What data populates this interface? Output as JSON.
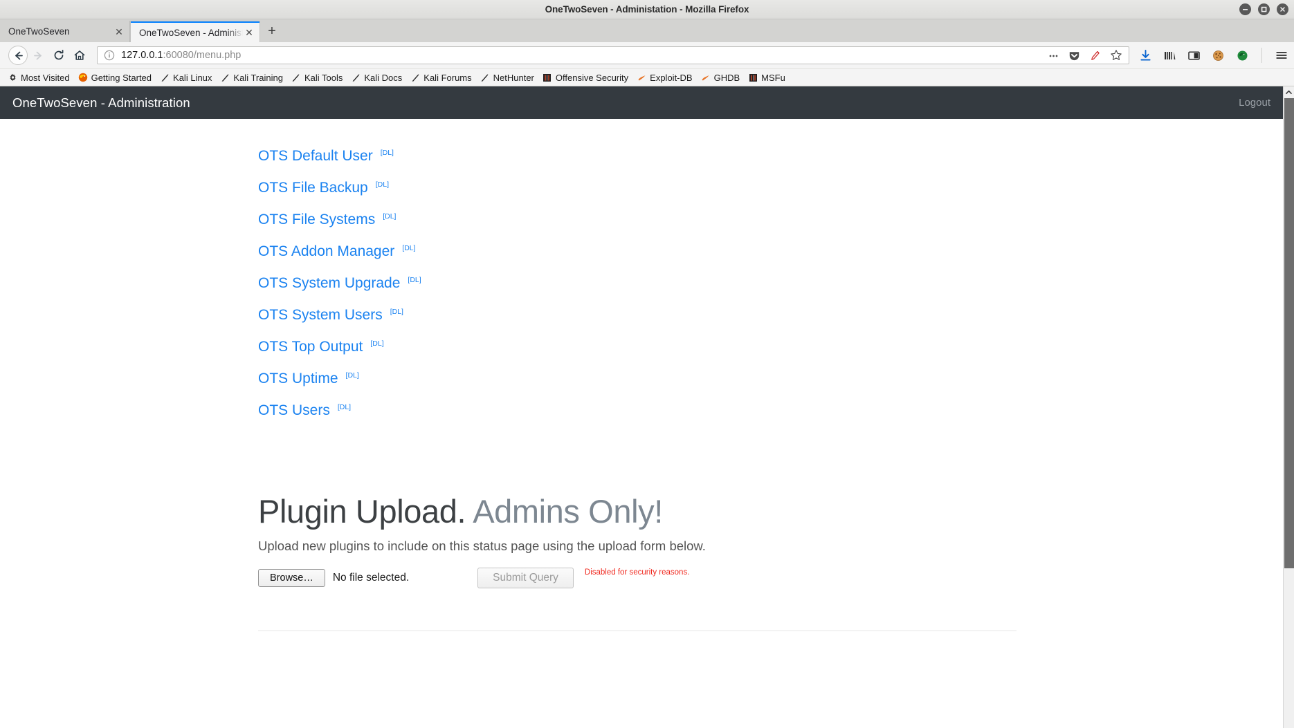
{
  "window": {
    "title": "OneTwoSeven - Administation - Mozilla Firefox",
    "controls": {
      "minimize": "minimize",
      "maximize": "maximize",
      "close": "close"
    }
  },
  "tabs": [
    {
      "label": "OneTwoSeven",
      "active": false
    },
    {
      "label": "OneTwoSeven - Administati",
      "active": true
    }
  ],
  "newtab_label": "+",
  "toolbar": {
    "back": "back-arrow",
    "forward": "forward-arrow",
    "reload": "reload",
    "home": "home",
    "url_host": "127.0.0.1",
    "url_rest": ":60080/menu.php",
    "url_full": "127.0.0.1:60080/menu.php",
    "page_actions": "page-actions-ellipsis",
    "pocket": "pocket-save",
    "reader": "reader-mode-pen",
    "bookmark": "bookmark-star",
    "downloads": "downloads-arrow",
    "library": "library-books",
    "sidebar": "sidebar-panel",
    "cookies": "cookie",
    "extension": "kali-dragon-extension",
    "menu": "hamburger-menu"
  },
  "bookmarks": [
    {
      "label": "Most Visited",
      "icon": "gear-icon"
    },
    {
      "label": "Getting Started",
      "icon": "firefox-icon"
    },
    {
      "label": "Kali Linux",
      "icon": "kali-dragon-icon"
    },
    {
      "label": "Kali Training",
      "icon": "kali-dragon-icon"
    },
    {
      "label": "Kali Tools",
      "icon": "kali-dragon-icon"
    },
    {
      "label": "Kali Docs",
      "icon": "kali-dragon-icon"
    },
    {
      "label": "Kali Forums",
      "icon": "kali-dragon-icon"
    },
    {
      "label": "NetHunter",
      "icon": "kali-dragon-icon"
    },
    {
      "label": "Offensive Security",
      "icon": "offsec-icon"
    },
    {
      "label": "Exploit-DB",
      "icon": "exploitdb-icon"
    },
    {
      "label": "GHDB",
      "icon": "exploitdb-icon"
    },
    {
      "label": "MSFu",
      "icon": "offsec-icon"
    }
  ],
  "page": {
    "header": {
      "brand": "OneTwoSeven - Administration",
      "logout": "Logout"
    },
    "plugin_links": [
      {
        "label": "OTS Default User",
        "dl": "[DL]"
      },
      {
        "label": "OTS File Backup",
        "dl": "[DL]"
      },
      {
        "label": "OTS File Systems",
        "dl": "[DL]"
      },
      {
        "label": "OTS Addon Manager",
        "dl": "[DL]"
      },
      {
        "label": "OTS System Upgrade",
        "dl": "[DL]"
      },
      {
        "label": "OTS System Users",
        "dl": "[DL]"
      },
      {
        "label": "OTS Top Output",
        "dl": "[DL]"
      },
      {
        "label": "OTS Uptime",
        "dl": "[DL]"
      },
      {
        "label": "OTS Users",
        "dl": "[DL]"
      }
    ],
    "upload": {
      "title_main": "Plugin Upload.",
      "title_muted": "Admins Only!",
      "subtitle": "Upload new plugins to include on this status page using the upload form below.",
      "browse_label": "Browse…",
      "file_status": "No file selected.",
      "submit_label": "Submit Query",
      "security_note": "Disabled for security reasons."
    }
  },
  "colors": {
    "header_bg": "#343a40",
    "link_blue": "#1a82f0",
    "warning_red": "#f0281e",
    "muted_gray": "#7d8791",
    "tab_accent": "#0a84ff"
  }
}
